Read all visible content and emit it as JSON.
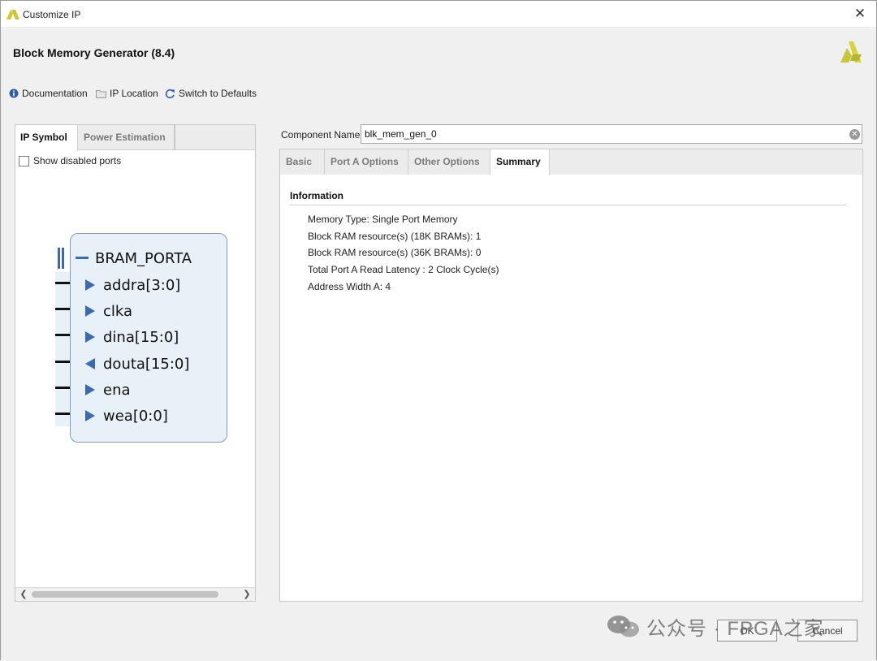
{
  "window": {
    "title": "Customize IP",
    "close_glyph": "✕"
  },
  "header": {
    "ip_title": "Block Memory Generator (8.4)"
  },
  "toolbar": {
    "documentation": "Documentation",
    "ip_location": "IP Location",
    "switch_defaults": "Switch to Defaults"
  },
  "left_panel": {
    "tabs": [
      {
        "label": "IP Symbol",
        "active": true
      },
      {
        "label": "Power Estimation",
        "active": false
      }
    ],
    "show_disabled_ports": "Show disabled ports",
    "symbol": {
      "bus_name": "BRAM_PORTA",
      "ports": [
        {
          "name": "addra[3:0]",
          "direction": "in"
        },
        {
          "name": "clka",
          "direction": "in"
        },
        {
          "name": "dina[15:0]",
          "direction": "in"
        },
        {
          "name": "douta[15:0]",
          "direction": "out"
        },
        {
          "name": "ena",
          "direction": "in"
        },
        {
          "name": "wea[0:0]",
          "direction": "in"
        }
      ]
    }
  },
  "component": {
    "label": "Component Name",
    "value": "blk_mem_gen_0"
  },
  "right_panel": {
    "tabs": [
      {
        "label": "Basic",
        "active": false
      },
      {
        "label": "Port A Options",
        "active": false
      },
      {
        "label": "Other Options",
        "active": false
      },
      {
        "label": "Summary",
        "active": true
      }
    ],
    "info_title": "Information",
    "info_lines": [
      "Memory Type: Single Port Memory",
      "Block RAM resource(s) (18K BRAMs): 1",
      "Block RAM resource(s) (36K BRAMs): 0",
      "Total Port A Read Latency : 2 Clock Cycle(s)",
      "Address Width A: 4"
    ]
  },
  "buttons": {
    "ok": "OK",
    "cancel": "Cancel"
  },
  "watermark": {
    "text": "公众号 · FPGA之家"
  },
  "colors": {
    "accent_blue": "#3b6ab0",
    "block_fill": "#e8f0f8",
    "logo_yellow": "#c9c63a"
  }
}
